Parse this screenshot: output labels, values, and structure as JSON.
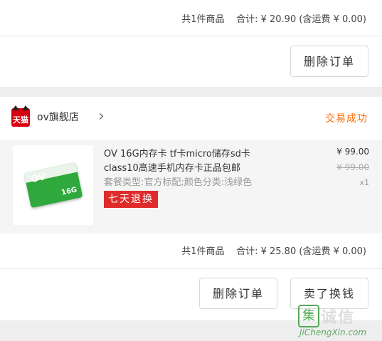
{
  "order1": {
    "summary": {
      "count_text": "共1件商品",
      "total_label": "合计:",
      "total": "¥ 20.90",
      "shipping": "(含运费 ¥ 0.00)"
    },
    "delete_button": "删除订单"
  },
  "order2": {
    "store": {
      "icon_text": "天猫",
      "name": "ov旗舰店",
      "status": "交易成功"
    },
    "product": {
      "title_line1": "OV 16G内存卡 tf卡micro储存sd卡",
      "title_line2": "class10高速手机内存卡正品包邮",
      "sku": "套餐类型:官方标配;颜色分类:浅绿色",
      "badge": "七天退换",
      "price": "¥ 99.00",
      "original_price": "¥ 99.00",
      "quantity": "x1",
      "image_ov": "OV",
      "image_capacity": "16G"
    },
    "summary": {
      "count_text": "共1件商品",
      "total_label": "合计:",
      "total": "¥ 25.80",
      "shipping": "(含运费 ¥ 0.00)"
    },
    "delete_button": "删除订单",
    "resell_button": "卖了换钱"
  },
  "watermark": {
    "char": "集",
    "text": "诚信",
    "url": "JiChengXin.com"
  },
  "colors": {
    "status": "#ff6a00",
    "badge": "#e02b2b",
    "tmall": "#d6000f"
  }
}
